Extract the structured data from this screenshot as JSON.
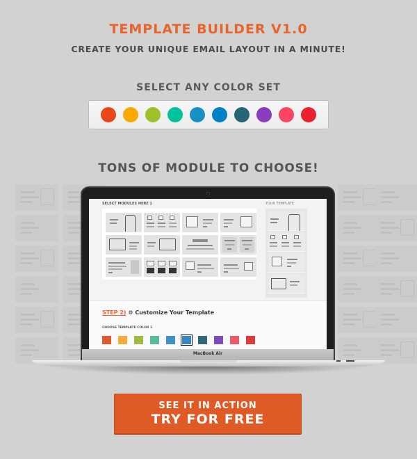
{
  "header": {
    "title": "TEMPLATE BUILDER V1.0",
    "subtitle": "CREATE YOUR UNIQUE EMAIL LAYOUT IN A MINUTE!"
  },
  "color_set": {
    "label": "SELECT ANY COLOR SET",
    "swatches": [
      {
        "name": "orange-red",
        "color": "#e9461a"
      },
      {
        "name": "amber",
        "color": "#fba800"
      },
      {
        "name": "lime",
        "color": "#9cc12a"
      },
      {
        "name": "teal",
        "color": "#00c39d"
      },
      {
        "name": "sky-blue",
        "color": "#1890c6"
      },
      {
        "name": "blue",
        "color": "#0082c8"
      },
      {
        "name": "slate",
        "color": "#266676"
      },
      {
        "name": "purple",
        "color": "#8a3dbd"
      },
      {
        "name": "pink",
        "color": "#fc4562"
      },
      {
        "name": "red",
        "color": "#e9232e"
      }
    ]
  },
  "modules_section": {
    "heading": "TONS OF MODULE TO CHOOSE!"
  },
  "laptop": {
    "brand_label": "MacBook Air",
    "screen": {
      "step1_label": "SELECT MODULES HERE 1",
      "your_template_label": "YOUR TEMPLATE",
      "step2_number": "STEP 2)",
      "step2_icon": "gear-icon",
      "step2_title": "Customize Your Template",
      "choose_color_label": "CHOOSE TEMPLATE COLOR 1",
      "template_colors": [
        {
          "color": "#dd5a2b",
          "selected": false
        },
        {
          "color": "#f4ad3a",
          "selected": false
        },
        {
          "color": "#a2ba40",
          "selected": false
        },
        {
          "color": "#56bf99",
          "selected": false
        },
        {
          "color": "#3e91c8",
          "selected": false
        },
        {
          "color": "#3786c4",
          "selected": true
        },
        {
          "color": "#336677",
          "selected": false
        },
        {
          "color": "#7a4cbd",
          "selected": false
        },
        {
          "color": "#ec5a6a",
          "selected": false
        },
        {
          "color": "#dc3a39",
          "selected": false
        }
      ]
    }
  },
  "cta": {
    "top_line": "SEE IT IN ACTION",
    "main_line": "TRY FOR FREE",
    "color": "#e05a25"
  }
}
